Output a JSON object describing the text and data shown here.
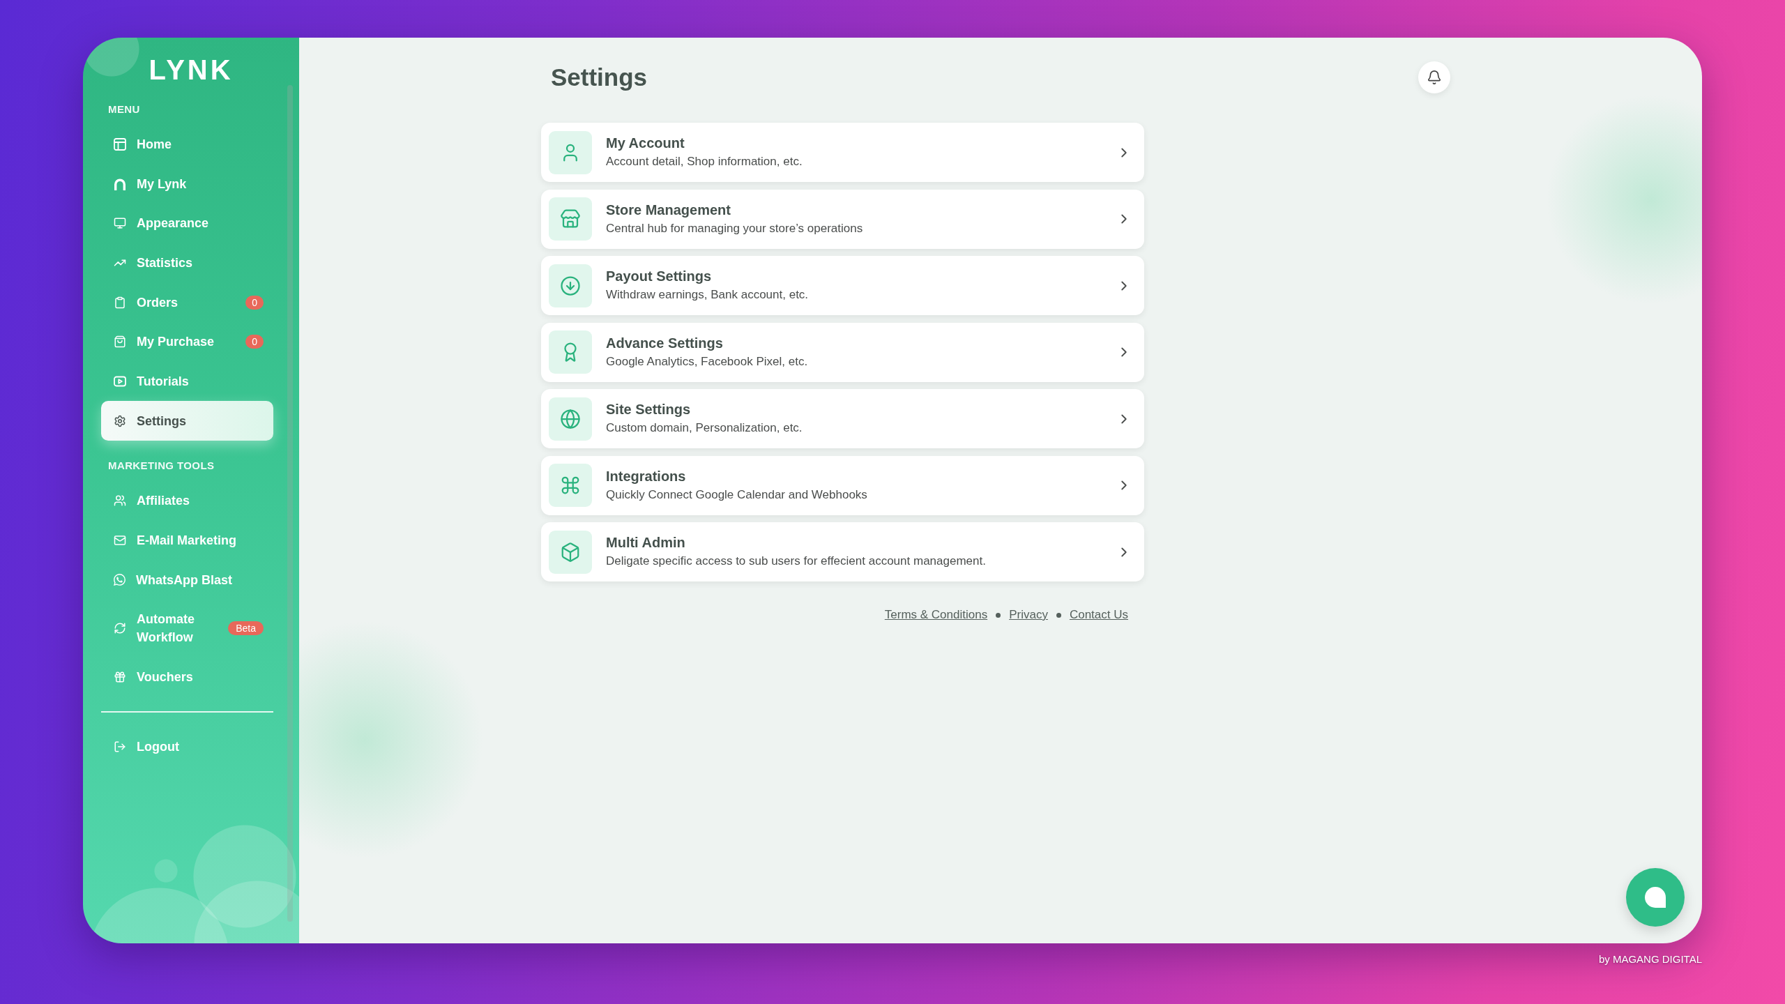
{
  "logo": "LYNK",
  "sidebar": {
    "sections": [
      {
        "title": "MENU",
        "items": [
          {
            "label": "Home",
            "selected": false
          },
          {
            "label": "My Lynk",
            "selected": false
          },
          {
            "label": "Appearance",
            "selected": false
          },
          {
            "label": "Statistics",
            "selected": false
          },
          {
            "label": "Orders",
            "badge": "0",
            "selected": false
          },
          {
            "label": "My Purchase",
            "badge": "0",
            "selected": false
          },
          {
            "label": "Tutorials",
            "selected": false
          },
          {
            "label": "Settings",
            "selected": true
          }
        ]
      },
      {
        "title": "MARKETING TOOLS",
        "items": [
          {
            "label": "Affiliates",
            "selected": false
          },
          {
            "label": "E-Mail Marketing",
            "selected": false
          },
          {
            "label": "WhatsApp Blast",
            "selected": false
          },
          {
            "label": "Automate Workflow",
            "badge": "Beta",
            "selected": false
          },
          {
            "label": "Vouchers",
            "selected": false
          }
        ]
      }
    ],
    "logout": {
      "label": "Logout"
    }
  },
  "page": {
    "title": "Settings"
  },
  "settings_list": [
    {
      "title": "My Account",
      "description": "Account detail, Shop information, etc."
    },
    {
      "title": "Store Management",
      "description": "Central hub for managing your store’s operations"
    },
    {
      "title": "Payout Settings",
      "description": "Withdraw earnings, Bank account, etc."
    },
    {
      "title": "Advance Settings",
      "description": "Google Analytics, Facebook Pixel, etc."
    },
    {
      "title": "Site Settings",
      "description": "Custom domain, Personalization, etc."
    },
    {
      "title": "Integrations",
      "description": "Quickly Connect Google Calendar and Webhooks"
    },
    {
      "title": "Multi Admin",
      "description": "Deligate specific access to sub users for effecient account management."
    }
  ],
  "footer_links": [
    "Terms & Conditions",
    "Privacy",
    "Contact Us"
  ],
  "credit": "by MAGANG DIGITAL"
}
